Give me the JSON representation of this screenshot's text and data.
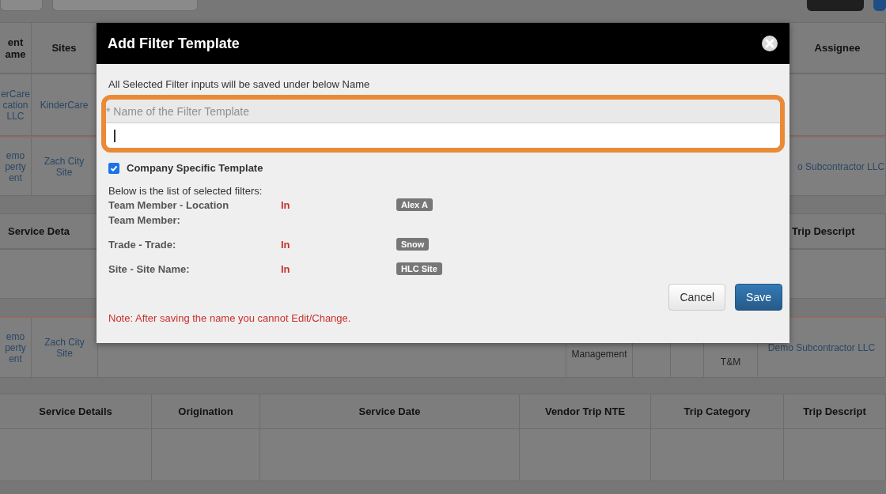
{
  "grid_1": {
    "columns": [
      "ent\name",
      "Sites",
      "Assignee"
    ],
    "rows": [
      [
        "erCare\ncation\nLLC",
        "KinderCare"
      ],
      [
        "emo\nperty\nent",
        "Zach City\nSite",
        "o Subcontractor LLC"
      ]
    ]
  },
  "grid_2": {
    "columns": [
      "Service Deta",
      "Trip Descript"
    ],
    "row": [
      "emo\nperty\nent",
      "Zach City\nSite",
      "Management",
      "T&M",
      "Demo Subcontractor LLC"
    ]
  },
  "grid_3": {
    "columns": [
      "Service Details",
      "Origination",
      "Service Date",
      "Vendor Trip NTE",
      "Trip Category",
      "Trip Descript"
    ]
  },
  "dialog": {
    "title": "Add Filter Template",
    "intro": "All Selected Filter inputs will be saved under below Name",
    "name_field": {
      "label": "* Name of the Filter Template"
    },
    "company_specific": {
      "label": "Company Specific Template",
      "checked": true
    },
    "filters_heading": "Below is the list of selected filters:",
    "filters": [
      {
        "label": "Team Member - Location Team Member:",
        "operator": "In",
        "value": "Alex A"
      },
      {
        "label": "Trade - Trade:",
        "operator": "In",
        "value": "Snow"
      },
      {
        "label": "Site - Site Name:",
        "operator": "In",
        "value": "HLC Site"
      }
    ],
    "buttons": [
      "Cancel",
      "Save"
    ],
    "note": "Note: After saving the name you cannot Edit/Change."
  }
}
